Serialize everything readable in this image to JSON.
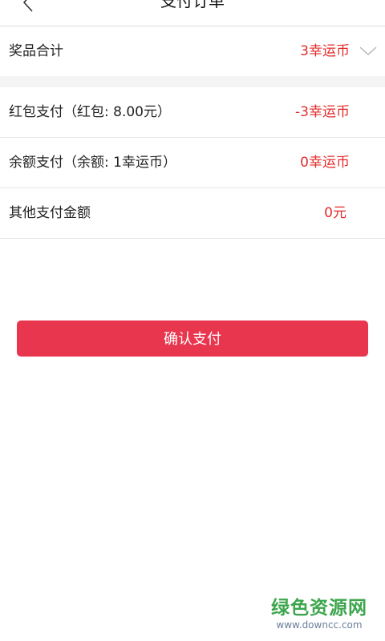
{
  "header": {
    "title": "支付订单",
    "back_icon": "chevron-left-icon"
  },
  "summary": {
    "label": "奖品合计",
    "value": "3幸运币",
    "expand_icon": "chevron-down-icon"
  },
  "payments": [
    {
      "label": "红包支付（红包: 8.00元）",
      "value": "-3幸运币"
    },
    {
      "label": "余额支付（余额: 1幸运币）",
      "value": "0幸运币"
    },
    {
      "label": "其他支付金额",
      "value": "0元"
    }
  ],
  "confirm_button": {
    "label": "确认支付"
  },
  "watermark": {
    "title": "绿色资源网",
    "url": "www.downcc.com"
  },
  "colors": {
    "accent": "#e8364e",
    "value_red": "#e22b2b",
    "watermark_green": "#3da64d"
  }
}
